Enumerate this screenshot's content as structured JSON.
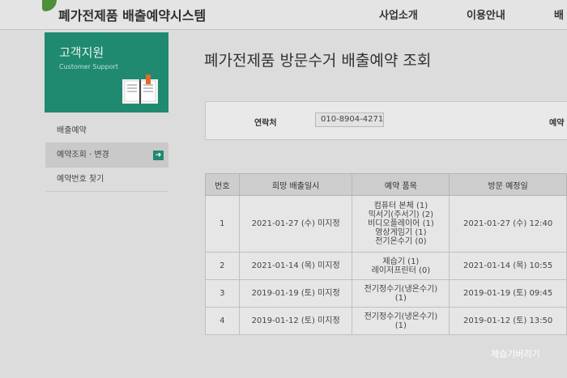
{
  "header": {
    "site_title": "폐가전제품 배출예약시스템",
    "nav": [
      "사업소개",
      "이용안내",
      "배"
    ]
  },
  "sidebar": {
    "banner_title": "고객지원",
    "banner_subtitle": "Customer Support",
    "items": [
      {
        "label": "배출예약"
      },
      {
        "label": "예약조회 · 변경",
        "arrow": "➜"
      },
      {
        "label": "예약번호 찾기"
      }
    ]
  },
  "main": {
    "title": "폐가전제품 방문수거 배출예약 조회",
    "search": {
      "contact_label": "연락처",
      "contact_value": "010-8904-4271",
      "reservation_label": "예약"
    },
    "table": {
      "headers": [
        "번호",
        "희망 배출일시",
        "예약 품목",
        "방문 예정일"
      ],
      "rows": [
        {
          "no": "1",
          "date": "2021-01-27 (수) 미지정",
          "items": [
            "컴퓨터 본체 (1)",
            "믹서기(주서기) (2)",
            "비디오플레이어 (1)",
            "영상게임기 (1)",
            "전기온수기 (0)"
          ],
          "visit": "2021-01-27 (수) 12:40"
        },
        {
          "no": "2",
          "date": "2021-01-14 (목) 미지정",
          "items": [
            "제습기 (1)",
            "레이저프린터 (0)"
          ],
          "visit": "2021-01-14 (목) 10:55"
        },
        {
          "no": "3",
          "date": "2019-01-19 (토) 미지정",
          "items": [
            "전기정수기(냉온수기)",
            "(1)"
          ],
          "visit": "2019-01-19 (토) 09:45"
        },
        {
          "no": "4",
          "date": "2019-01-12 (토) 미지정",
          "items": [
            "전기정수기(냉온수기)",
            "(1)"
          ],
          "visit": "2019-01-12 (토) 13:50"
        }
      ]
    }
  },
  "watermark": "제습기버리기"
}
